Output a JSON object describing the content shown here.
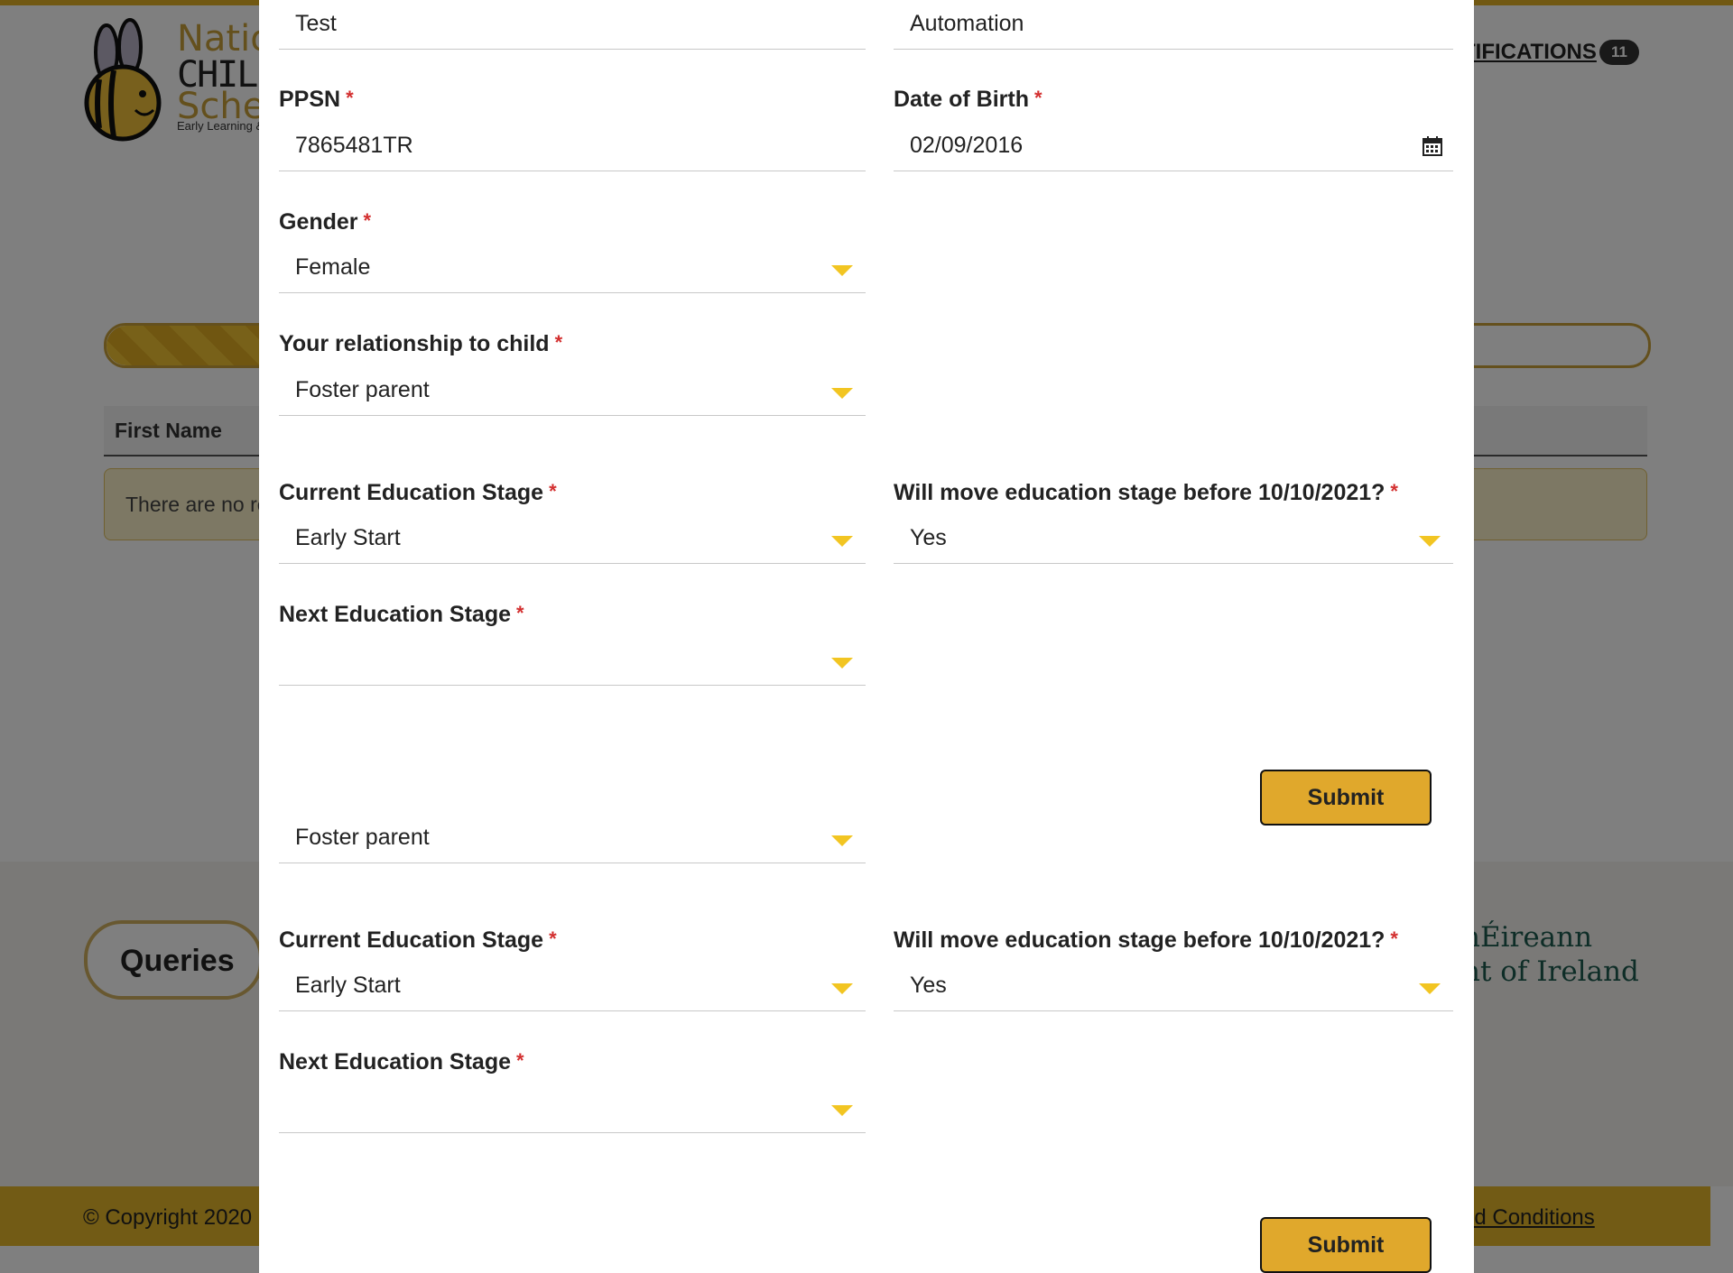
{
  "background": {
    "logo": {
      "line1": "Nation",
      "line2": "CHILDCA",
      "line3": "Schen",
      "tagline": "Early Learning &"
    },
    "notifications_label": "TIFICATIONS",
    "notifications_count": "11",
    "progress_fraction": 0.12,
    "table_header_first_name": "First Name",
    "empty_message": "There are no re",
    "queries_label": "Queries",
    "gov_line1": "hÉireann",
    "gov_line2": "nt of Ireland",
    "copyright": "© Copyright 2020",
    "terms": "nd Conditions"
  },
  "modal": {
    "first_name_value": "Test",
    "last_name_value": "Automation",
    "ppsn": {
      "label": "PPSN",
      "value": "7865481TR"
    },
    "dob": {
      "label": "Date of Birth",
      "value": "02/09/2016",
      "icon": "calendar-icon"
    },
    "gender": {
      "label": "Gender",
      "value": "Female"
    },
    "relationship": {
      "label": "Your relationship to child",
      "value": "Foster parent"
    },
    "current_stage": {
      "label": "Current Education Stage",
      "value": "Early Start"
    },
    "will_move": {
      "label": "Will move education stage before 10/10/2021?",
      "value": "Yes"
    },
    "next_stage": {
      "label": "Next Education Stage",
      "value": ""
    },
    "submit_label": "Submit",
    "repeat": {
      "relationship_value": "Foster parent",
      "current_stage": {
        "label": "Current Education Stage",
        "value": "Early Start"
      },
      "will_move": {
        "label": "Will move education stage before 10/10/2021?",
        "value": "Yes"
      },
      "next_stage": {
        "label": "Next Education Stage",
        "value": ""
      },
      "submit_label": "Submit"
    },
    "required_marker": "*"
  },
  "colors": {
    "accent": "#e0a82c",
    "caret": "#f2c522",
    "required": "#d32f2f"
  }
}
